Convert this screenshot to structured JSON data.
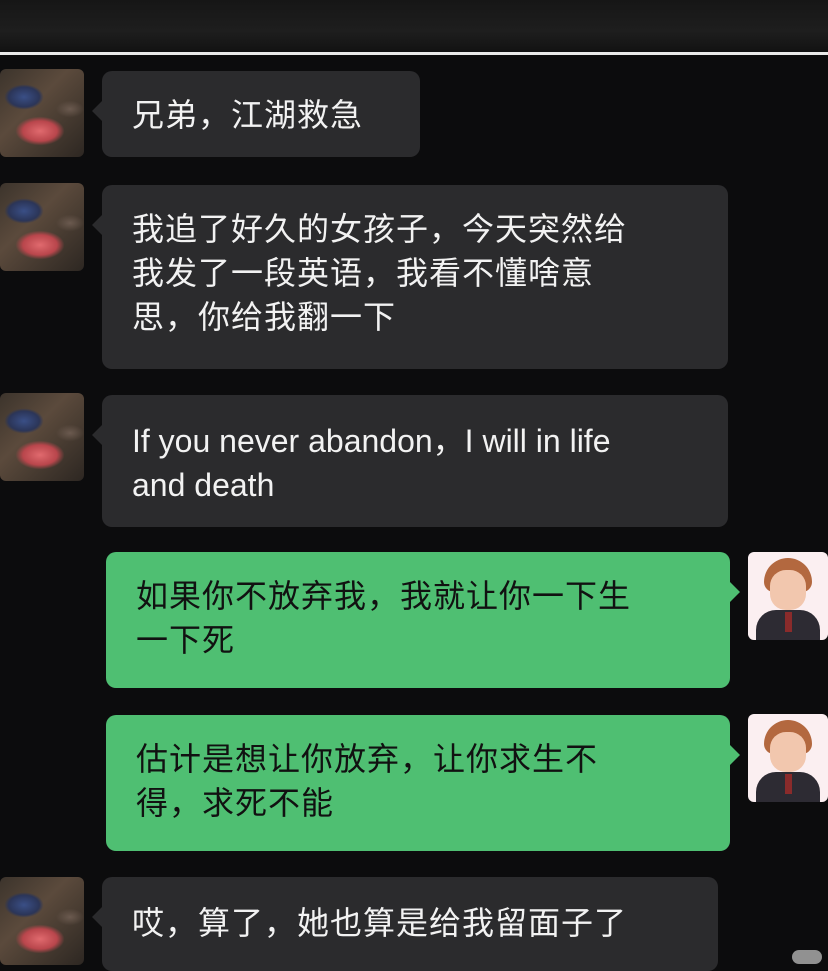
{
  "messages": [
    {
      "side": "left",
      "text": "兄弟，江湖救急"
    },
    {
      "side": "left",
      "text": "我追了好久的女孩子，今天突然给\n我发了一段英语，我看不懂啥意\n思，你给我翻一下"
    },
    {
      "side": "left",
      "text": "If you never abandon，I will in life\nand death"
    },
    {
      "side": "right",
      "text": "如果你不放弃我，我就让你一下生\n一下死"
    },
    {
      "side": "right",
      "text": "估计是想让你放弃，让你求生不\n得，求死不能"
    },
    {
      "side": "left",
      "text": "哎，算了，她也算是给我留面子了"
    }
  ],
  "avatars": {
    "left": "friend-avatar",
    "right": "user-avatar"
  },
  "colors": {
    "background": "#0c0c0d",
    "bubble_left": "#2b2b2d",
    "bubble_right": "#4fbf72"
  }
}
